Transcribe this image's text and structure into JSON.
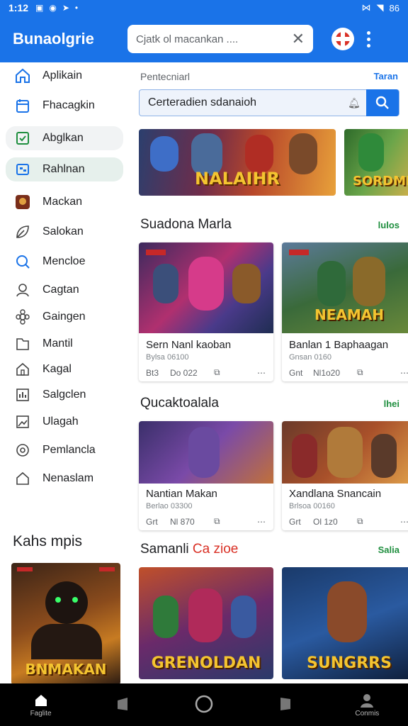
{
  "status_bar": {
    "time": "1:12",
    "battery_text": "86"
  },
  "app": {
    "title": "Bunaolgrie",
    "search_placeholder": "Cjatk ol macankan ....",
    "avatar_label": "avatar"
  },
  "sidebar": {
    "items": [
      {
        "label": "Aplikain",
        "icon": "home-icon"
      },
      {
        "label": "Fhacagkin",
        "icon": "calendar-icon"
      },
      {
        "label": "Abglkan",
        "icon": "checkbox-icon"
      },
      {
        "label": "Rahlnan",
        "icon": "grid-icon"
      },
      {
        "label": "Mackan",
        "icon": "game-avatar-icon"
      },
      {
        "label": "Salokan",
        "icon": "leaf-icon"
      },
      {
        "label": "Mencloe",
        "icon": "search-circle-icon"
      },
      {
        "label": "Cagtan",
        "icon": "person-icon"
      },
      {
        "label": "Gaingen",
        "icon": "gear-flower-icon"
      },
      {
        "label": "Mantil",
        "icon": "folder-icon"
      },
      {
        "label": "Kagal",
        "icon": "house-outline-icon"
      },
      {
        "label": "Salgclen",
        "icon": "chart-icon"
      },
      {
        "label": "Ulagah",
        "icon": "image-icon"
      },
      {
        "label": "Pemlancla",
        "icon": "target-icon"
      },
      {
        "label": "Nenaslam",
        "icon": "home-outline-icon"
      }
    ],
    "featured_heading": "Kahs mpis",
    "featured_caption": "BNMAKAN"
  },
  "main": {
    "breadcrumb": "Pentecniarl",
    "breadcrumb_link": "Taran",
    "filter_text": "Certeradien sdanaioh",
    "banners": [
      {
        "caption": "NALAIHR"
      },
      {
        "caption": "SORDME"
      }
    ],
    "sections": [
      {
        "title": "Suadona Marla",
        "link": "lulos",
        "cards": [
          {
            "caption": "",
            "title": "Sern Nanl kaoban",
            "subtitle": "Bylsa 06100",
            "m1": "Bt3",
            "m2": "Do 022"
          },
          {
            "caption": "NEAMAH",
            "title": "Banlan 1 Baphaagan",
            "subtitle": "Gnsan 0160",
            "m1": "Gnt",
            "m2": "Nl1o20"
          }
        ]
      },
      {
        "title": "Qucaktoalala",
        "link": "lhei",
        "cards": [
          {
            "caption": "",
            "title": "Nantian Makan",
            "subtitle": "Berlao 03300",
            "m1": "Grt",
            "m2": "Nl 870"
          },
          {
            "caption": "",
            "title": "Xandlana Snancain",
            "subtitle": "Brlsoa 00160",
            "m1": "Grt",
            "m2": "Ol 1z0"
          }
        ]
      },
      {
        "title_part1": "Samanli ",
        "title_part2": "Ca zioe",
        "link": "Salia",
        "cards": [
          {
            "caption": "GRENOLDAN"
          },
          {
            "caption": "SUNGRRS"
          }
        ]
      }
    ]
  },
  "bottom_nav": {
    "home_label": "Faglite",
    "profile_label": "Conmis"
  },
  "colors": {
    "primary": "#1a73e8",
    "accent_red": "#d93025",
    "accent_green": "#1e8e3e"
  }
}
